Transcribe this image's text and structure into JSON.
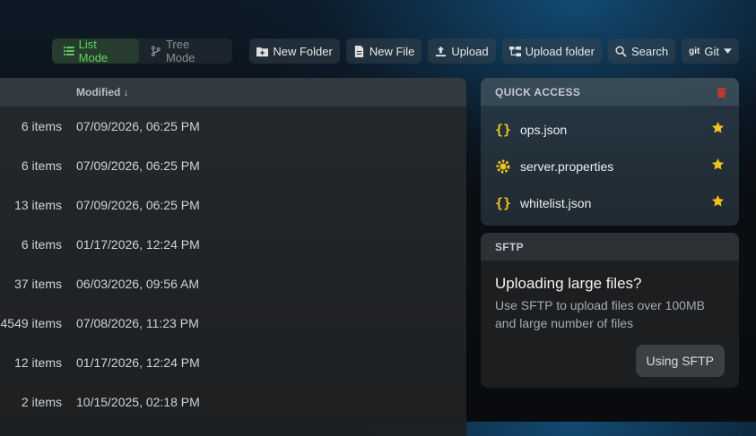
{
  "toolbar": {
    "list_mode": "List Mode",
    "tree_mode": "Tree Mode",
    "new_folder": "New Folder",
    "new_file": "New File",
    "upload": "Upload",
    "upload_folder": "Upload folder",
    "search": "Search",
    "git_prefix": "git",
    "git": "Git"
  },
  "files": {
    "header_modified": "Modified ↓",
    "rows": [
      {
        "items": "6 items",
        "modified": "07/09/2026, 06:25 PM"
      },
      {
        "items": "6 items",
        "modified": "07/09/2026, 06:25 PM"
      },
      {
        "items": "13 items",
        "modified": "07/09/2026, 06:25 PM"
      },
      {
        "items": "6 items",
        "modified": "01/17/2026, 12:24 PM"
      },
      {
        "items": "37 items",
        "modified": "06/03/2026, 09:56 AM"
      },
      {
        "items": "4549 items",
        "modified": "07/08/2026, 11:23 PM"
      },
      {
        "items": "12 items",
        "modified": "01/17/2026, 12:24 PM"
      },
      {
        "items": "2 items",
        "modified": "10/15/2025, 02:18 PM"
      }
    ]
  },
  "quick_access": {
    "title": "QUICK ACCESS",
    "items": [
      {
        "name": "ops.json",
        "icon": "json-file-icon"
      },
      {
        "name": "server.properties",
        "icon": "properties-file-icon"
      },
      {
        "name": "whitelist.json",
        "icon": "json-file-icon"
      }
    ]
  },
  "sftp": {
    "title": "SFTP",
    "heading": "Uploading large files?",
    "description": "Use SFTP to upload files over 100MB and large number of files",
    "button": "Using SFTP"
  },
  "colors": {
    "accent_green": "#5dd65a",
    "star_yellow": "#f1c21b",
    "trash_red": "#c0392b"
  }
}
